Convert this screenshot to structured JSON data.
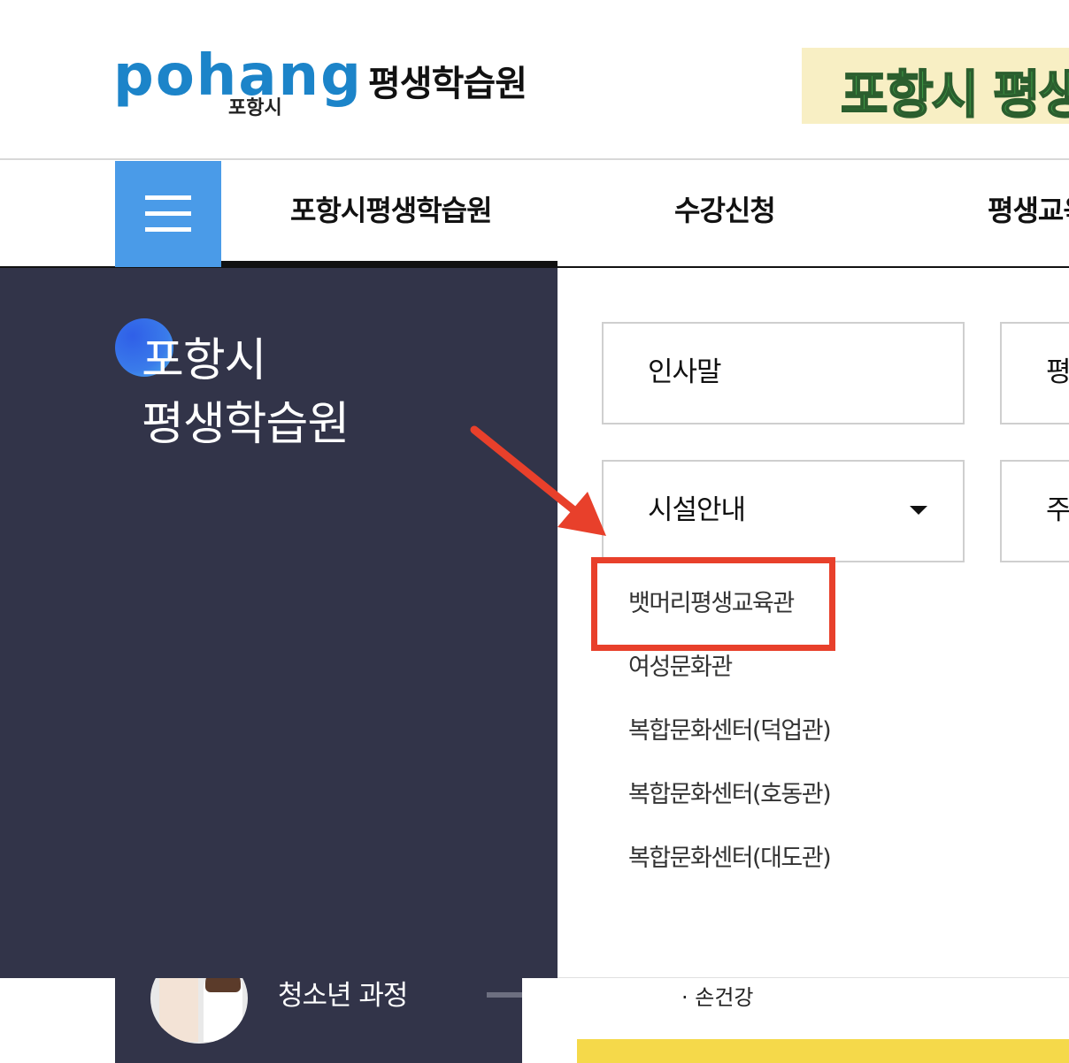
{
  "header": {
    "logo_word": "pohang",
    "logo_sub": "포항시",
    "site_title": "평생학습원",
    "banner_text": "포항시 평생"
  },
  "nav": {
    "menu_icon": "hamburger-icon",
    "items": [
      "포항시평생학습원",
      "수강신청",
      "평생교육"
    ]
  },
  "panel": {
    "title_line1": "포항시",
    "title_line2": "평생학습원"
  },
  "submenu": {
    "box1": "인사말",
    "box2_partial": "평",
    "box3": "시설안내",
    "box4_partial": "주",
    "facilities": [
      "뱃머리평생교육관",
      "여성문화관",
      "복합문화센터(덕업관)",
      "복합문화센터(호동관)",
      "복합문화센터(대도관)"
    ]
  },
  "bottom": {
    "youth_label": "청소년 과정",
    "hand_label": "· 손건강"
  },
  "colors": {
    "menu_blue": "#4a9be8",
    "panel_dark": "#323449",
    "highlight_red": "#e8402b",
    "banner_green": "#3d9b45"
  }
}
